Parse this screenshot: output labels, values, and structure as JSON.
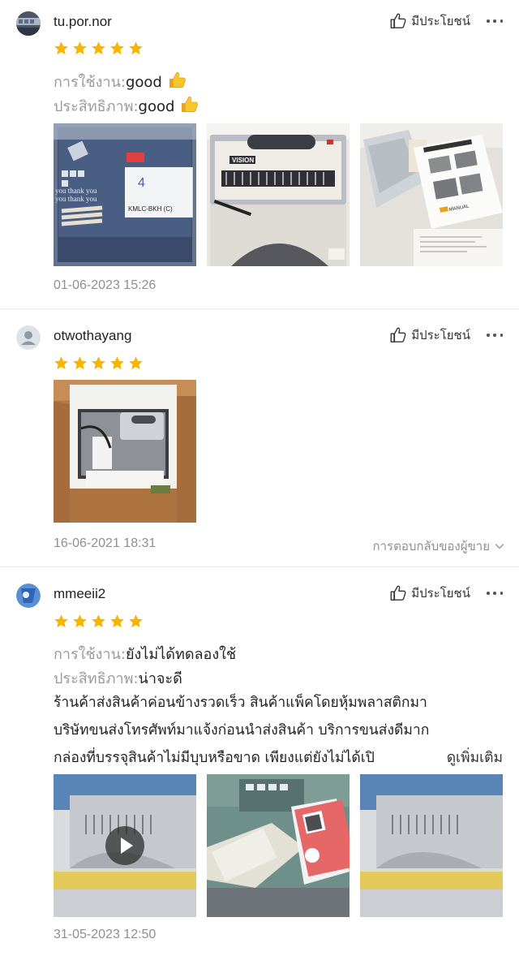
{
  "common": {
    "helpful_label": "มีประโยชน์",
    "star_color": "#f7b500"
  },
  "reviews": [
    {
      "username": "tu.por.nor",
      "rating": 5,
      "usage_key": "การใช้งาน:",
      "usage_val": "good",
      "usage_emoji": "thumbs-up",
      "perf_key": "ประสิทธิภาพ:",
      "perf_val": "good",
      "perf_emoji": "thumbs-up",
      "photo_text_1": "KMLC-BKH (C)",
      "photo_text_2": "VISION",
      "photo_text_3": "MANUAL",
      "date": "01-06-2023 15:26"
    },
    {
      "username": "otwothayang",
      "rating": 5,
      "photo_count": 1,
      "date": "16-06-2021 18:31",
      "seller_reply_label": "การตอบกลับของผู้ขาย"
    },
    {
      "username": "mmeeii2",
      "rating": 5,
      "usage_key": "การใช้งาน:",
      "usage_val": "ยังไม่ได้ทดลองใช้",
      "perf_key": "ประสิทธิภาพ:",
      "perf_val": "น่าจะดี",
      "body_lines": [
        "ร้านค้าส่งสินค้าค่อนข้างรวดเร็ว สินค้าแพ็คโดยหุ้มพลาสติกมา",
        "บริษัทขนส่งโทรศัพท์มาแจ้งก่อนนำส่งสินค้า บริการขนส่งดีมาก",
        "กล่องที่บรรจุสินค้าไม่มีบุบหรือขาด เพียงแต่ยังไม่ได้เปิ"
      ],
      "see_more": "ดูเพิ่มเติม",
      "photo_has_video": true,
      "date": "31-05-2023 12:50"
    }
  ]
}
